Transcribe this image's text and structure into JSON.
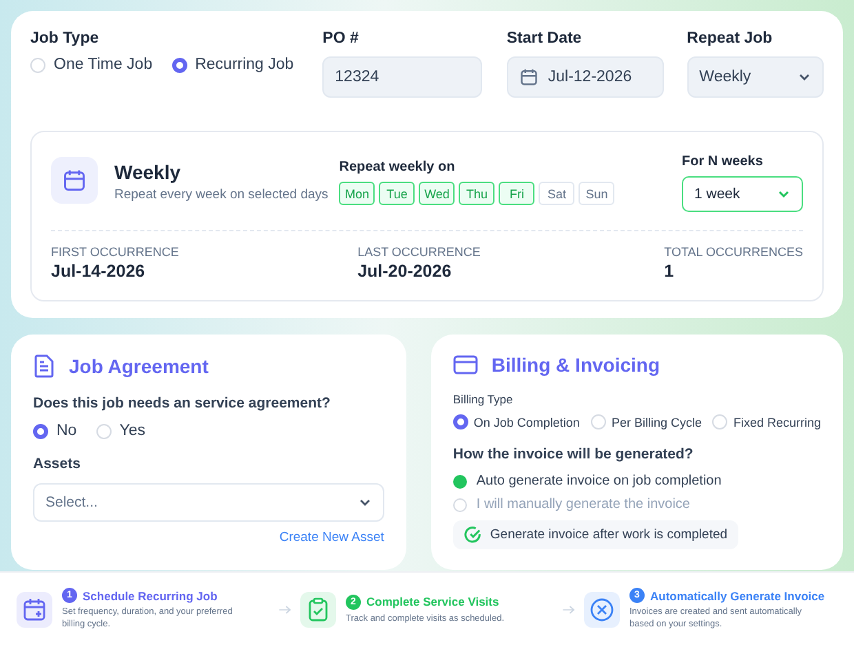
{
  "job_type": {
    "label": "Job Type",
    "options": [
      {
        "label": "One Time Job",
        "selected": false
      },
      {
        "label": "Recurring Job",
        "selected": true
      }
    ]
  },
  "po": {
    "label": "PO #",
    "value": "12324"
  },
  "start_date": {
    "label": "Start Date",
    "value": "Jul-12-2026"
  },
  "repeat_job": {
    "label": "Repeat Job",
    "value": "Weekly"
  },
  "schedule": {
    "title": "Weekly",
    "subtitle": "Repeat every week on selected days",
    "days_label": "Repeat weekly on",
    "days": [
      {
        "label": "Mon",
        "selected": true
      },
      {
        "label": "Tue",
        "selected": true
      },
      {
        "label": "Wed",
        "selected": true
      },
      {
        "label": "Thu",
        "selected": true
      },
      {
        "label": "Fri",
        "selected": true
      },
      {
        "label": "Sat",
        "selected": false
      },
      {
        "label": "Sun",
        "selected": false
      }
    ],
    "weeks_label": "For N weeks",
    "weeks_value": "1 week",
    "stats": [
      {
        "label": "FIRST OCCURRENCE",
        "value": "Jul-14-2026"
      },
      {
        "label": "LAST OCCURRENCE",
        "value": "Jul-20-2026"
      },
      {
        "label": "TOTAL OCCURRENCES",
        "value": "1"
      }
    ]
  },
  "agreement": {
    "title": "Job Agreement",
    "question": "Does this job needs an service agreement?",
    "options": [
      {
        "label": "No",
        "selected": true
      },
      {
        "label": "Yes",
        "selected": false
      }
    ],
    "assets_label": "Assets",
    "assets_placeholder": "Select...",
    "create_link": "Create New Asset"
  },
  "billing": {
    "title": "Billing & Invoicing",
    "type_label": "Billing Type",
    "types": [
      {
        "label": "On Job Completion",
        "selected": true
      },
      {
        "label": "Per Billing Cycle",
        "selected": false
      },
      {
        "label": "Fixed Recurring",
        "selected": false
      }
    ],
    "question": "How the invoice will be generated?",
    "methods": [
      {
        "label": "Auto generate invoice on job completion",
        "selected": true
      },
      {
        "label": "I will manually generate the invoice",
        "selected": false
      }
    ],
    "note": "Generate invoice after work is completed"
  },
  "steps": [
    {
      "kind": "schedule",
      "number": "1",
      "title": "Schedule Recurring Job",
      "description": "Set frequency, duration, and your preferred billing cycle.",
      "color": "#6366f1"
    },
    {
      "kind": "visits",
      "number": "2",
      "title": "Complete Service Visits",
      "description": "Track and complete visits as scheduled.",
      "color": "#22c55e"
    },
    {
      "kind": "invoice",
      "number": "3",
      "title": "Automatically Generate Invoice",
      "description": "Invoices are created and sent automatically based on your settings.",
      "color": "#3b82f6"
    }
  ]
}
